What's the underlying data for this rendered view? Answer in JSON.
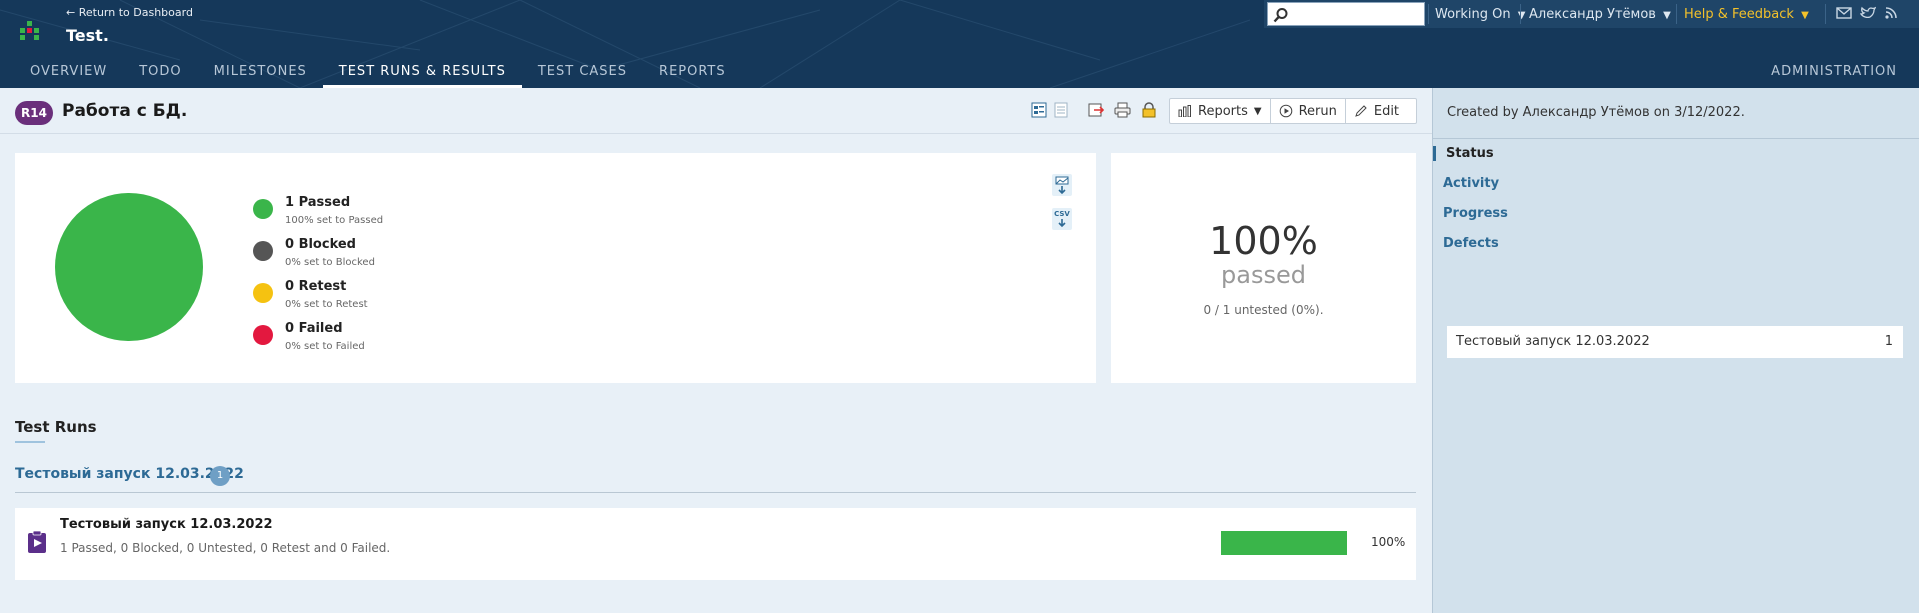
{
  "header": {
    "back_link": "← Return to Dashboard",
    "project_title": "Test.",
    "search_placeholder": "",
    "working_on": "Working On",
    "user": "Александр Утёмов",
    "help": "Help & Feedback",
    "icons": [
      "search-icon",
      "mail-icon",
      "twitter-icon",
      "rss-icon"
    ]
  },
  "nav": {
    "tabs": [
      {
        "label": "Overview",
        "active": false
      },
      {
        "label": "Todo",
        "active": false
      },
      {
        "label": "Milestones",
        "active": false
      },
      {
        "label": "Test Runs & Results",
        "active": true
      },
      {
        "label": "Test Cases",
        "active": false
      },
      {
        "label": "Reports",
        "active": false
      }
    ],
    "admin": "Administration"
  },
  "run": {
    "badge": "R14",
    "title": "Работа с БД.",
    "buttons": {
      "reports": "Reports",
      "rerun": "Rerun",
      "edit": "Edit"
    }
  },
  "stats": {
    "legend": [
      {
        "label": "1 Passed",
        "sub": "100% set to Passed",
        "color": "#3ab54a"
      },
      {
        "label": "0 Blocked",
        "sub": "0% set to Blocked",
        "color": "#555555"
      },
      {
        "label": "0 Retest",
        "sub": "0% set to Retest",
        "color": "#f5c211"
      },
      {
        "label": "0 Failed",
        "sub": "0% set to Failed",
        "color": "#e3183f"
      }
    ],
    "export_csv": "CSV",
    "pass_percent": "100%",
    "pass_word": "passed",
    "untested": "0 / 1 untested (0%)."
  },
  "chart_data": {
    "type": "pie",
    "categories": [
      "Passed",
      "Blocked",
      "Retest",
      "Failed"
    ],
    "values": [
      1,
      0,
      0,
      0
    ],
    "colors": [
      "#3ab54a",
      "#555555",
      "#f5c211",
      "#e3183f"
    ]
  },
  "runs_section": {
    "title": "Test Runs",
    "group_title": "Тестовый запуск 12.03.2022",
    "group_count": "1",
    "items": [
      {
        "name": "Тестовый запуск 12.03.2022",
        "summary": "1 Passed, 0 Blocked, 0 Untested, 0 Retest and 0 Failed.",
        "progress": 1.0,
        "progress_label": "100%"
      }
    ]
  },
  "sidebar": {
    "created": "Created by Александр Утёмов on 3/12/2022.",
    "links": [
      "Status",
      "Activity",
      "Progress",
      "Defects"
    ],
    "active_link": "Status",
    "run_name": "Тестовый запуск 12.03.2022",
    "run_count": "1"
  }
}
